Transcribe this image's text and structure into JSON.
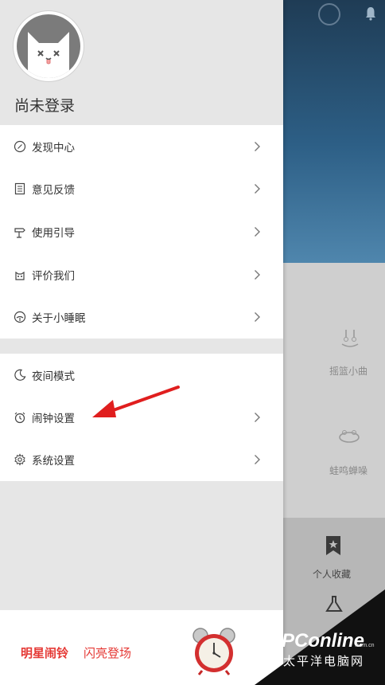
{
  "drawer": {
    "username": "尚未登录",
    "menu_group_1": [
      {
        "label": "发现中心",
        "icon": "compass-icon"
      },
      {
        "label": "意见反馈",
        "icon": "document-icon"
      },
      {
        "label": "使用引导",
        "icon": "guide-icon"
      },
      {
        "label": "评价我们",
        "icon": "rate-icon"
      },
      {
        "label": "关于小睡眠",
        "icon": "info-icon"
      }
    ],
    "menu_group_2": [
      {
        "label": "夜间模式",
        "icon": "moon-icon"
      },
      {
        "label": "闹钟设置",
        "icon": "alarm-clock-icon"
      },
      {
        "label": "系统设置",
        "icon": "gear-icon"
      }
    ],
    "promo": {
      "bold": "明星闹铃",
      "rest": " 闪亮登场"
    }
  },
  "background": {
    "labels": [
      "摇篮小曲",
      "蛙鸣蝉噪",
      "个人收藏"
    ]
  },
  "watermark": {
    "brand": "PConline",
    "domain": ".com.cn",
    "cn": "太平洋电脑网"
  },
  "colors": {
    "accent": "#e53935",
    "header": "#2d5f86"
  }
}
